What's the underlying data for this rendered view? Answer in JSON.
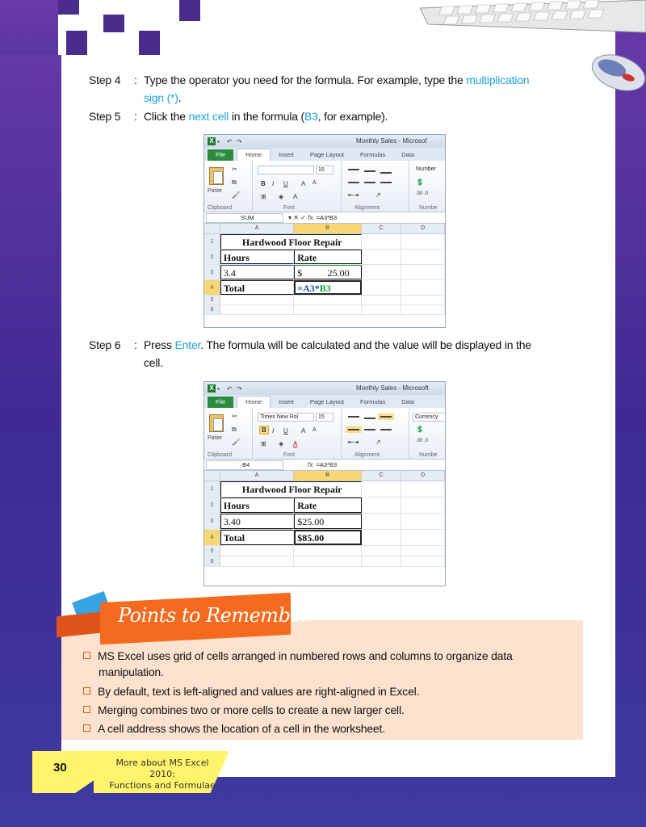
{
  "steps": [
    {
      "label": "Step 4",
      "colon": ":",
      "text_before": "Type the operator you need for the formula. For example, type the ",
      "highlight": "multiplication",
      "line2_highlight": "sign (*)",
      "line2_after": "."
    },
    {
      "label": "Step 5",
      "colon": ":",
      "text_before": "Click the ",
      "highlight": "next cell",
      "text_mid": " in the formula (",
      "highlight2": "B3",
      "text_after": ", for example)."
    },
    {
      "label": "Step 6",
      "colon": ":",
      "text_before": "Press ",
      "highlight": "Enter",
      "text_after": ". The formula will be calculated and the value will be displayed in the",
      "line2": "cell."
    }
  ],
  "excel1": {
    "window_title": "Monthly Sales - Microsof",
    "tabs": [
      "File",
      "Home",
      "Insert",
      "Page Layout",
      "Formulas",
      "Data"
    ],
    "font_name": "",
    "font_size": "15",
    "number_label": "Number",
    "paste_label": "Paste",
    "groups": [
      "Clipboard",
      "Font",
      "Alignment",
      "Numbe"
    ],
    "name_box": "SUM",
    "formula": "=A3*B3",
    "columns": [
      "A",
      "B",
      "C",
      "D"
    ],
    "rows": [
      {
        "num": "1",
        "a": "Hardwood Floor Repair",
        "b": ""
      },
      {
        "num": "2",
        "a": "Hours",
        "b": "Rate"
      },
      {
        "num": "3",
        "a": "3.4",
        "b_cur": "$",
        "b": "25.00"
      },
      {
        "num": "4",
        "a": "Total",
        "b_p1": "=A3*",
        "b_p2": "B3"
      },
      {
        "num": "5",
        "a": "",
        "b": ""
      },
      {
        "num": "6",
        "a": "",
        "b": ""
      }
    ]
  },
  "excel2": {
    "window_title": "Monthly Sales - Microsoft",
    "tabs": [
      "File",
      "Home",
      "Insert",
      "Page Layout",
      "Formulas",
      "Data"
    ],
    "font_name": "Times New Roi",
    "font_size": "15",
    "number_label": "Currency",
    "paste_label": "Paste",
    "groups": [
      "Clipboard",
      "Font",
      "Alignment",
      "Numbe"
    ],
    "name_box": "B4",
    "formula": "=A3*B3",
    "columns": [
      "A",
      "B",
      "C",
      "D"
    ],
    "rows": [
      {
        "num": "1",
        "a": "Hardwood Floor Repair",
        "b": ""
      },
      {
        "num": "2",
        "a": "Hours",
        "b": "Rate"
      },
      {
        "num": "3",
        "a": "3.40",
        "b": "$25.00"
      },
      {
        "num": "4",
        "a": "Total",
        "b": "$85.00"
      },
      {
        "num": "5",
        "a": "",
        "b": ""
      },
      {
        "num": "6",
        "a": "",
        "b": ""
      }
    ]
  },
  "points": {
    "title": "Points to Remember",
    "items": [
      {
        "line1": "MS Excel uses grid of cells arranged in numbered rows and columns to organize data",
        "line2": "manipulation."
      },
      {
        "line1": "By default, text is left-aligned and values are right-aligned in Excel."
      },
      {
        "line1": "Merging combines two or more cells to create a new larger cell."
      },
      {
        "line1": "A cell address shows the location of a cell in the worksheet."
      }
    ]
  },
  "footer": {
    "page_number": "30",
    "chapter_line1": "More about MS Excel 2010:",
    "chapter_line2": "Functions and Formulae"
  },
  "colors": {
    "accent_blue": "#1fa3d8",
    "purple": "#4a2c8c",
    "orange": "#f56a1e",
    "yellow": "#fff46a",
    "excel_green": "#2a8a3e"
  }
}
